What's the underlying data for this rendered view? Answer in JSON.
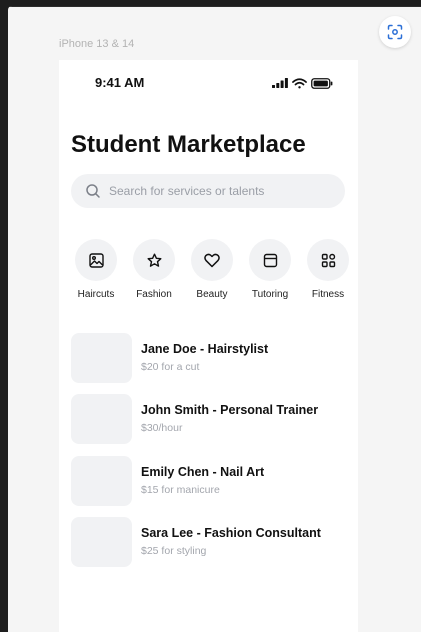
{
  "frame": {
    "label": "iPhone 13 & 14"
  },
  "status_bar": {
    "time": "9:41 AM"
  },
  "page": {
    "title": "Student Marketplace"
  },
  "search": {
    "placeholder": "Search for services or talents"
  },
  "categories": [
    {
      "label": "Haircuts",
      "icon": "image-icon"
    },
    {
      "label": "Fashion",
      "icon": "star-icon"
    },
    {
      "label": "Beauty",
      "icon": "heart-icon"
    },
    {
      "label": "Tutoring",
      "icon": "browser-window-icon"
    },
    {
      "label": "Fitness",
      "icon": "grid-icon"
    }
  ],
  "listings": [
    {
      "name": "Jane Doe - Hairstylist",
      "price": "$20 for a cut"
    },
    {
      "name": "John Smith - Personal Trainer",
      "price": "$30/hour"
    },
    {
      "name": "Emily Chen - Nail Art",
      "price": "$15 for manicure"
    },
    {
      "name": "Sara Lee - Fashion Consultant",
      "price": "$25 for styling"
    }
  ]
}
